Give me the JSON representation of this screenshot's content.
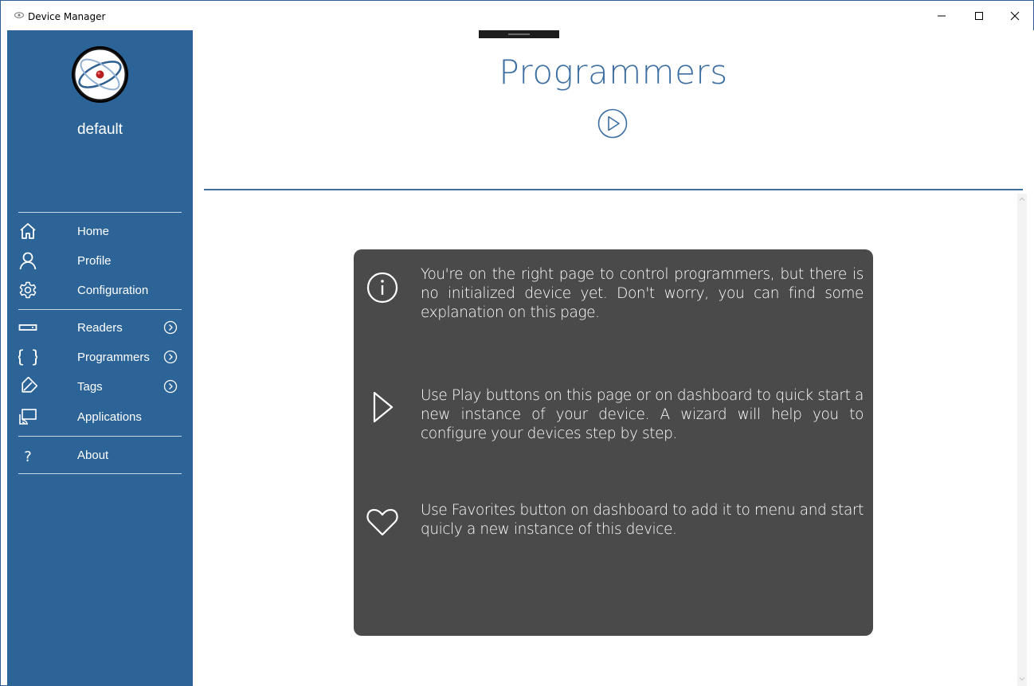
{
  "window": {
    "title": "Device Manager",
    "controls": {
      "minimize": "minimize-icon",
      "maximize": "maximize-icon",
      "close": "close-icon"
    }
  },
  "sidebar": {
    "profile_name": "default",
    "avatar_icon": "app-logo",
    "groups": [
      [
        {
          "label": "Home",
          "icon": "home-icon"
        },
        {
          "label": "Profile",
          "icon": "user-icon"
        },
        {
          "label": "Configuration",
          "icon": "gear-icon"
        }
      ],
      [
        {
          "label": "Readers",
          "icon": "reader-icon",
          "chevron": true
        },
        {
          "label": "Programmers",
          "icon": "braces-icon",
          "chevron": true
        },
        {
          "label": "Tags",
          "icon": "tag-icon",
          "chevron": true
        },
        {
          "label": "Applications",
          "icon": "cast-icon"
        }
      ],
      [
        {
          "label": "About",
          "icon": "question-icon"
        }
      ]
    ]
  },
  "main": {
    "title": "Programmers",
    "play_button_icon": "play-circle-icon",
    "info": [
      {
        "icon": "info-icon",
        "text": "You're on the right page to control programmers, but there is no initialized device yet. Don't worry, you can find some explanation on this page."
      },
      {
        "icon": "play-icon",
        "text": "Use Play buttons on this page or on dashboard to quick start a new instance of your device. A wizard will help you to configure your devices step by step."
      },
      {
        "icon": "heart-icon",
        "text": "Use Favorites button on dashboard to add it to menu and start quicly a new instance of this device."
      }
    ]
  },
  "colors": {
    "sidebar_bg": "#2d6498",
    "accent": "#3c6ea2",
    "card_bg": "#4a4a4a"
  }
}
